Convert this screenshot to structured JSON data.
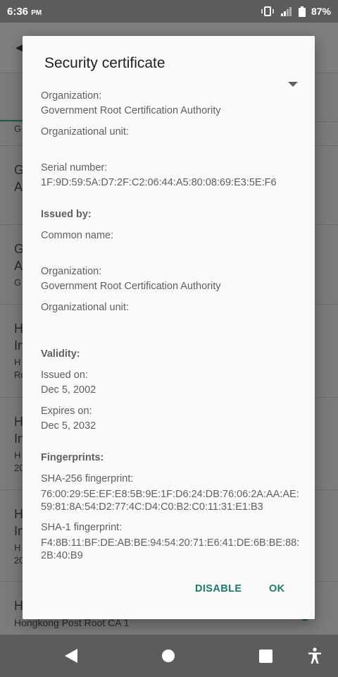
{
  "status_bar": {
    "time": "6:36",
    "ampm": "PM",
    "battery": "87%"
  },
  "background": {
    "rows": [
      {
        "title": "G",
        "subtitle": ""
      },
      {
        "title": "G",
        "line2": "A",
        "subtitle": ""
      },
      {
        "title": "G",
        "line2": "A",
        "subtitle": "G"
      },
      {
        "title": "H",
        "line2": "In",
        "subtitle": "H",
        "subtitle2": "Ro"
      },
      {
        "title": "H",
        "line2": "In",
        "subtitle": "H",
        "subtitle2": "20"
      },
      {
        "title": "H",
        "line2": "In",
        "subtitle": "H",
        "subtitle2": "20"
      },
      {
        "title": "H",
        "subtitle": "Hongkong Post Root CA 1"
      }
    ]
  },
  "dialog": {
    "title": "Security certificate",
    "fields": {
      "org_label_1": "Organization:",
      "org_value_1": "Government Root Certification Authority",
      "ou_label_1": "Organizational unit:",
      "serial_label": "Serial number:",
      "serial_value": "1F:9D:59:5A:D7:2F:C2:06:44:A5:80:08:69:E3:5E:F6",
      "issued_by_header": "Issued by:",
      "cn_label": "Common name:",
      "org_label_2": "Organization:",
      "org_value_2": "Government Root Certification Authority",
      "ou_label_2": "Organizational unit:",
      "validity_header": "Validity:",
      "issued_on_label": "Issued on:",
      "issued_on_value": "Dec 5, 2002",
      "expires_on_label": "Expires on:",
      "expires_on_value": "Dec 5, 2032",
      "fingerprints_header": "Fingerprints:",
      "sha256_label": "SHA-256 fingerprint:",
      "sha256_value": "76:00:29:5E:EF:E8:5B:9E:1F:D6:24:DB:76:06:2A:AA:AE:59:81:8A:54:D2:77:4C:D4:C0:B2:C0:11:31:E1:B3",
      "sha1_label": "SHA-1 fingerprint:",
      "sha1_value": "F4:8B:11:BF:DE:AB:BE:94:54:20:71:E6:41:DE:6B:BE:88:2B:40:B9"
    },
    "disable_label": "DISABLE",
    "ok_label": "OK"
  },
  "colors": {
    "accent": "#1c7a6b",
    "scrim": "#7b7b7b",
    "dialog_bg": "#fafafa"
  }
}
